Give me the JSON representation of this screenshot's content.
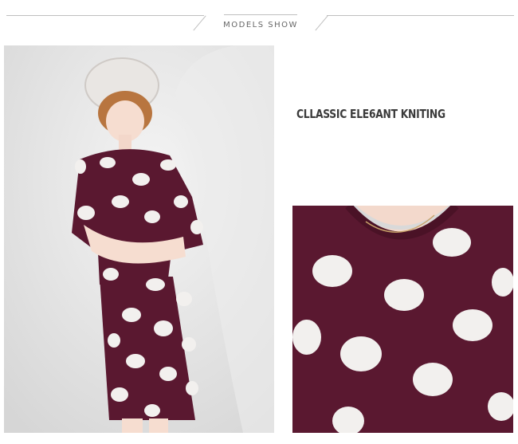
{
  "header": {
    "title": "MODELS SHOW"
  },
  "feature": {
    "caption": "CLLASSIC ELE6ANT KNITING"
  },
  "colors": {
    "dress": "#5a1830",
    "dots": "#f2f0ee",
    "rule": "#bfbfbf",
    "backdrop": "#e8e8e8"
  }
}
